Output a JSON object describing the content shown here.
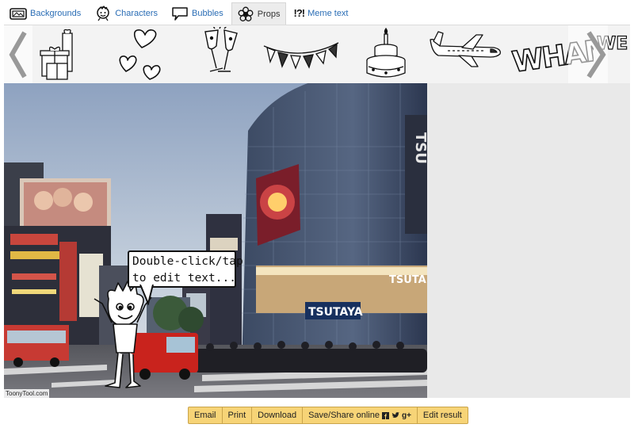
{
  "tabs": [
    {
      "label": "Backgrounds",
      "icon": "background-icon"
    },
    {
      "label": "Characters",
      "icon": "character-icon"
    },
    {
      "label": "Bubbles",
      "icon": "bubble-icon"
    },
    {
      "label": "Props",
      "icon": "flower-icon",
      "active": true
    },
    {
      "label": "Meme text",
      "icon": "meme-text-icon",
      "icon_text": "!?!"
    }
  ],
  "props": [
    "gifts",
    "hearts",
    "champagne-glasses",
    "bunting-flags",
    "birthday-cake",
    "airplane",
    "wham-text",
    "wham-text-2"
  ],
  "props_text": {
    "wham": "WHAM!",
    "wham_partial": "WE"
  },
  "canvas": {
    "background": "city-street-scene",
    "watermark": "ToonyTool.com",
    "bubble_lines": [
      "Double-click/tap",
      "to edit text..."
    ],
    "signs": {
      "tsutaya": "TSUTAYA",
      "tsuta_top": "TSUTA",
      "tsu": "TSU"
    }
  },
  "actions": {
    "email": "Email",
    "print": "Print",
    "download": "Download",
    "share": "Save/Share online",
    "share_icons": [
      "facebook-icon",
      "twitter-icon",
      "google-plus-icon"
    ],
    "edit": "Edit result"
  },
  "colors": {
    "button_bg": "#f7d477",
    "link": "#2a6db5",
    "strip_bg": "#f3f3f3"
  }
}
